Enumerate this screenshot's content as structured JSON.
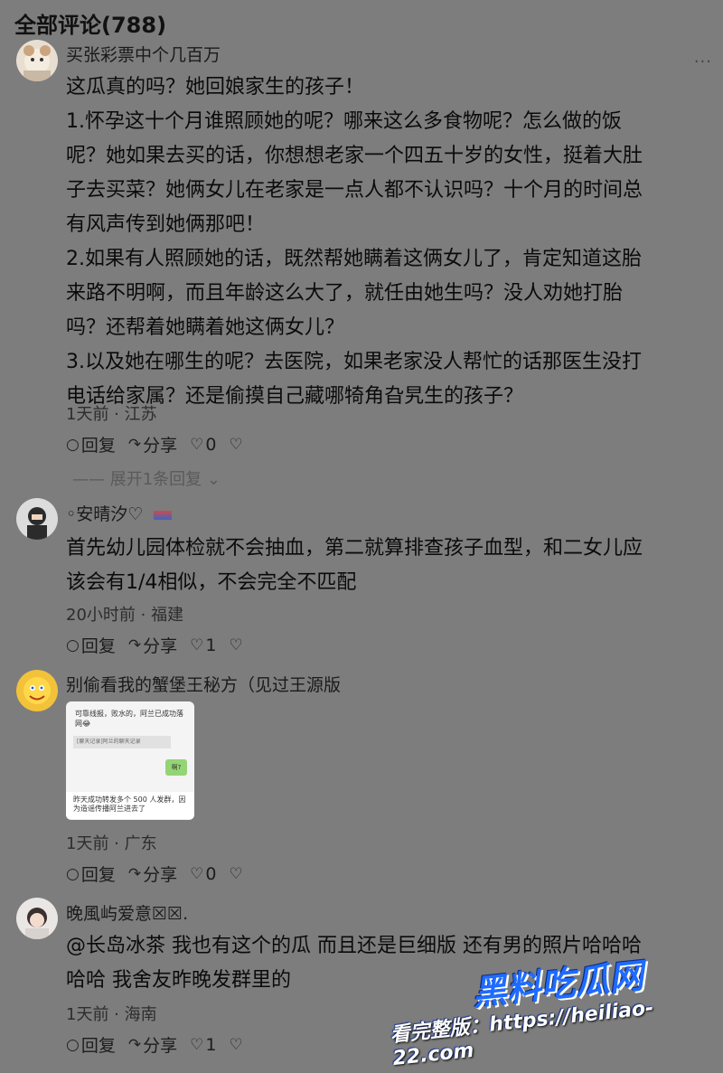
{
  "header": {
    "title": "全部评论(788)"
  },
  "more_icon": "more-dots-icon",
  "comments": [
    {
      "username": "买张彩票中个几百万",
      "lines": [
        "这瓜真的吗？她回娘家生的孩子！",
        "1.怀孕这十个月谁照顾她的呢？哪来这么多食物呢？怎么做的饭",
        "呢？她如果去买的话，你想想老家一个四五十岁的女性，挺着大肚",
        "子去买菜？她俩女儿在老家是一点人都不认识吗？十个月的时间总",
        "有风声传到她俩那吧！",
        "2.如果有人照顾她的话，既然帮她瞒着这俩女儿了，肯定知道这胎",
        "来路不明啊，而且年龄这么大了，就任由她生吗？没人劝她打胎",
        "吗？还帮着她瞒着她这俩女儿？",
        "3.以及她在哪生的呢？去医院，如果老家没人帮忙的话那医生没打",
        "电话给家属？还是偷摸自己藏哪犄角旮旯生的孩子？"
      ],
      "meta": "1天前 · 江苏",
      "reply": "回复",
      "share": "分享",
      "likes": "0",
      "expand": "展开1条回复"
    },
    {
      "username": "安晴汐",
      "lines": [
        "首先幼儿园体检就不会抽血，第二就算排查孩子血型，和二女儿应",
        "该会有1/4相似，不会完全不匹配"
      ],
      "meta": "20小时前 · 福建",
      "reply": "回复",
      "share": "分享",
      "likes": "1"
    },
    {
      "username": "别偷看我的蟹堡王秘方（见过王源版",
      "image": {
        "text1": "可靠线报，败水的，阿兰已成功落网😂",
        "text2": "[聊天记录]阿兰的聊天记录",
        "bubble": "啊?",
        "text3": "昨天成功转发多个 500 人发群，因为造谣传播阿兰进去了"
      },
      "meta": "1天前 · 广东",
      "reply": "回复",
      "share": "分享",
      "likes": "0"
    },
    {
      "username": "晚風屿爱意☒☒.",
      "lines": [
        "@长岛冰茶 我也有这个的瓜 而且还是巨细版 还有男的照片哈哈哈",
        "哈哈 我舍友昨晚发群里的"
      ],
      "meta": "1天前 · 海南",
      "reply": "回复",
      "share": "分享",
      "likes": "1"
    }
  ],
  "watermark": {
    "brand": "黑料吃瓜网",
    "text": "看完整版：https://heiliao-22.com"
  },
  "colors": {
    "background": "#7d7d7d",
    "watermark_blue": "#1f6bff"
  }
}
